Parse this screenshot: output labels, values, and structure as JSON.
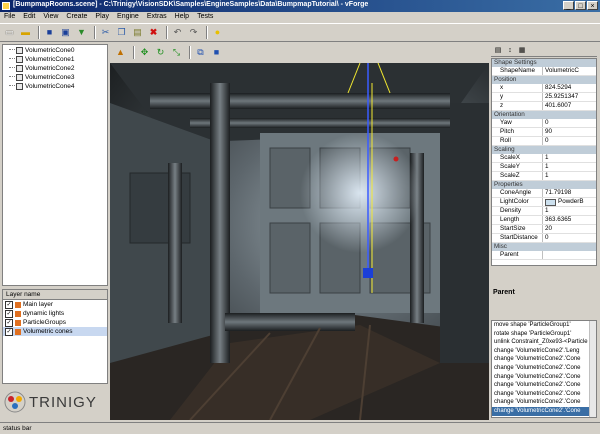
{
  "window": {
    "title": "[BumpmapRooms.scene] - C:\\Trinigy\\VisionSDK\\Samples\\EngineSamples\\Data\\BumpmapTutorial\\ - vForge",
    "min": "_",
    "max": "□",
    "close": "×"
  },
  "menu": [
    "File",
    "Edit",
    "View",
    "Create",
    "Play",
    "Engine",
    "Extras",
    "Help",
    "Tests"
  ],
  "toolbar_icons": [
    "new-icon",
    "open-icon",
    "save-icon",
    "save-all-icon",
    "export-icon",
    "cut-icon",
    "copy-icon",
    "paste-icon",
    "delete-icon",
    "undo-icon",
    "redo-icon",
    "lightbulb-icon"
  ],
  "scene_tree": [
    "VolumetricCone0",
    "VolumetricCone1",
    "VolumetricCone2",
    "VolumetricCone3",
    "VolumetricCone4"
  ],
  "layers": {
    "header": "Layer name",
    "items": [
      {
        "label": "Main layer",
        "checked": true,
        "selected": false
      },
      {
        "label": "dynamic lights",
        "checked": true,
        "selected": false
      },
      {
        "label": "ParticleGroups",
        "checked": true,
        "selected": false
      },
      {
        "label": "Volumetric cones",
        "checked": true,
        "selected": true
      }
    ]
  },
  "logo": {
    "text": "TRINIGY"
  },
  "properties": {
    "groups": [
      {
        "name": "Shape Settings",
        "rows": [
          {
            "k": "ShapeName",
            "v": "VolumetricC"
          }
        ]
      },
      {
        "name": "Position",
        "rows": [
          {
            "k": "x",
            "v": "824.5294"
          },
          {
            "k": "y",
            "v": "25.9251347"
          },
          {
            "k": "z",
            "v": "401.6007"
          }
        ]
      },
      {
        "name": "Orientation",
        "rows": [
          {
            "k": "Yaw",
            "v": "0"
          },
          {
            "k": "Pitch",
            "v": "90"
          },
          {
            "k": "Roll",
            "v": "0"
          }
        ]
      },
      {
        "name": "Scaling",
        "rows": [
          {
            "k": "ScaleX",
            "v": "1"
          },
          {
            "k": "ScaleY",
            "v": "1"
          },
          {
            "k": "ScaleZ",
            "v": "1"
          }
        ]
      },
      {
        "name": "Properties",
        "rows": [
          {
            "k": "ConeAngle",
            "v": "71.79198"
          },
          {
            "k": "LightColor",
            "v": "PowderB",
            "swatch": "#cce0ee"
          },
          {
            "k": "Density",
            "v": "1"
          },
          {
            "k": "Length",
            "v": "363.6365"
          },
          {
            "k": "StartSize",
            "v": "20"
          },
          {
            "k": "StartDistance",
            "v": "0"
          }
        ]
      },
      {
        "name": "Misc",
        "rows": [
          {
            "k": "Parent",
            "v": ""
          }
        ]
      }
    ]
  },
  "parent": {
    "title": "Parent"
  },
  "history": [
    "move shape 'ParticleGroup1'",
    "rotate shape 'ParticleGroup1'",
    "unlink Constraint_Z0xe93-<Particle",
    "change 'VolumetricCone2'.'Leng",
    "change 'VolumetricCone2'.'Cone",
    "change 'VolumetricCone2'.'Cone",
    "change 'VolumetricCone2'.'Cone",
    "change 'VolumetricCone2'.'Cone",
    "change 'VolumetricCone2'.'Cone",
    "change 'VolumetricCone2'.'Cone",
    "change 'VolumetricCone2'.'Cone"
  ],
  "history_selected": 10,
  "status": "status bar"
}
